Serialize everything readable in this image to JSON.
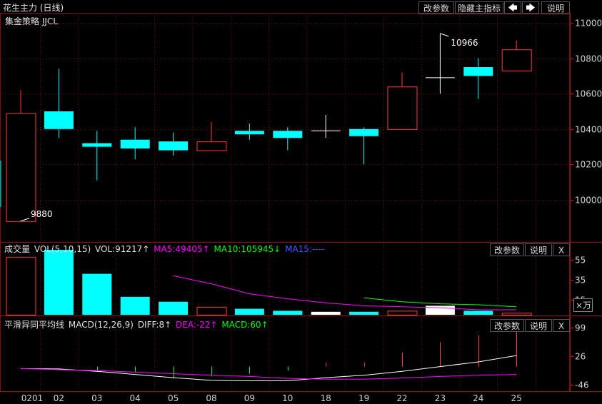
{
  "window": {
    "title": "花生主力 (日线)",
    "strategy_label": "集金策略 JJCL"
  },
  "toolbar": {
    "params_label": "改参数",
    "hide_indicator_label": "隐藏主指标",
    "left_arrow": "🡄",
    "right_arrow": "🡆",
    "help_label": "说明"
  },
  "price_panel": {
    "y_ticks": [
      "11000",
      "10800",
      "10600",
      "10400",
      "10200",
      "10000"
    ],
    "y_values": [
      11000,
      10800,
      10600,
      10400,
      10200,
      10000
    ],
    "high_annotation": "10966",
    "low_annotation": "9880"
  },
  "volume_panel": {
    "name": "成交量",
    "indicator": "VOL(5,10,15)",
    "vol_label": "VOL:91217↑",
    "ma5_label": "MA5:49405↑",
    "ma10_label": "MA10:105945↓",
    "ma15_label": "MA15:----",
    "params_label": "改参数",
    "help_label": "说明",
    "close_label": "X",
    "y_ticks": [
      "55",
      "35",
      "15"
    ],
    "unit_label": "×万"
  },
  "macd_panel": {
    "name": "平滑异同平均线",
    "indicator": "MACD(12,26,9)",
    "diff_label": "DIFF:8↑",
    "dea_label": "DEA:-22↑",
    "macd_label": "MACD:60↑",
    "params_label": "改参数",
    "help_label": "说明",
    "close_label": "X",
    "y_ticks": [
      "99",
      "26",
      "-46"
    ]
  },
  "x_axis": {
    "labels": [
      "0201",
      "02",
      "03",
      "04",
      "05",
      "08",
      "09",
      "10",
      "18",
      "19",
      "22",
      "23",
      "24",
      "25"
    ]
  },
  "colors": {
    "up": "#ff3b3b",
    "down": "#00ffff",
    "doji": "#ffffff",
    "ma5": "#ff00ff",
    "ma10": "#00ff00",
    "ma15": "#3a5cff",
    "grid": "#7a1010"
  },
  "chart_data": {
    "type": "candlestick",
    "categories": [
      "0201",
      "02",
      "03",
      "04",
      "05",
      "08",
      "09",
      "10",
      "18",
      "19",
      "22",
      "23",
      "24",
      "25"
    ],
    "ohlc": [
      {
        "open": 9880,
        "high": 10620,
        "low": 9880,
        "close": 10490
      },
      {
        "open": 10500,
        "high": 10740,
        "low": 10350,
        "close": 10400
      },
      {
        "open": 10320,
        "high": 10390,
        "low": 10110,
        "close": 10300
      },
      {
        "open": 10340,
        "high": 10410,
        "low": 10230,
        "close": 10290
      },
      {
        "open": 10330,
        "high": 10380,
        "low": 10250,
        "close": 10280
      },
      {
        "open": 10280,
        "high": 10440,
        "low": 10280,
        "close": 10330
      },
      {
        "open": 10390,
        "high": 10430,
        "low": 10340,
        "close": 10370
      },
      {
        "open": 10390,
        "high": 10410,
        "low": 10280,
        "close": 10350
      },
      {
        "open": 10390,
        "high": 10480,
        "low": 10350,
        "close": 10390
      },
      {
        "open": 10400,
        "high": 10410,
        "low": 10200,
        "close": 10360
      },
      {
        "open": 10400,
        "high": 10720,
        "low": 10400,
        "close": 10640
      },
      {
        "open": 10690,
        "high": 10940,
        "low": 10600,
        "close": 10690
      },
      {
        "open": 10750,
        "high": 10800,
        "low": 10570,
        "close": 10700
      },
      {
        "open": 10730,
        "high": 10900,
        "low": 10730,
        "close": 10850
      }
    ],
    "volume": [
      58,
      65,
      41,
      18,
      13,
      8,
      6,
      4,
      3,
      3,
      4,
      9,
      4,
      2
    ],
    "volume_ylim": [
      0,
      60
    ],
    "ma5_volume": [
      null,
      null,
      null,
      null,
      39,
      31,
      21,
      16,
      12,
      9,
      8,
      7,
      5,
      5
    ],
    "ma10_volume": [
      null,
      null,
      null,
      null,
      null,
      null,
      null,
      null,
      null,
      17,
      13,
      11,
      10,
      8
    ],
    "macd_hist": [
      0,
      0,
      -10,
      -15,
      -30,
      -25,
      -18,
      -10,
      10,
      10,
      35,
      62,
      80,
      120
    ],
    "macd_diff": [
      -5,
      -6,
      -12,
      -20,
      -28,
      -35,
      -36,
      -36,
      -28,
      -22,
      -12,
      0,
      12,
      28
    ],
    "macd_dea": [
      -5,
      -8,
      -10,
      -14,
      -18,
      -22,
      -25,
      -30,
      -32,
      -32,
      -29,
      -25,
      -22,
      -20
    ],
    "macd_ylim": [
      -46,
      99
    ]
  }
}
